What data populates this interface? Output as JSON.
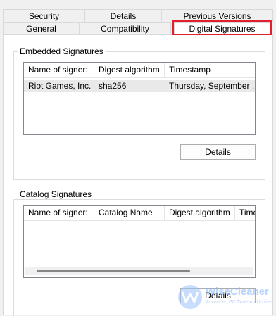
{
  "tabs": {
    "row1": [
      "Security",
      "Details",
      "Previous Versions"
    ],
    "row2": [
      "General",
      "Compatibility",
      "Digital Signatures"
    ],
    "active": "Digital Signatures"
  },
  "embedded": {
    "group_label": "Embedded Signatures",
    "columns": [
      "Name of signer:",
      "Digest algorithm",
      "Timestamp"
    ],
    "rows": [
      {
        "signer": "Riot Games, Inc.",
        "digest": "sha256",
        "timestamp": "Thursday, September ..."
      }
    ],
    "details_button": "Details"
  },
  "catalog": {
    "group_label": "Catalog Signatures",
    "columns": [
      "Name of signer:",
      "Catalog Name",
      "Digest algorithm",
      "Time"
    ],
    "details_button": "Details"
  },
  "watermark": {
    "name": "WiseCleaner",
    "tagline": "Advanced PC Tune-up Utilities"
  },
  "colors": {
    "highlight": "#e0202e",
    "watermark": "#7db4ff"
  }
}
